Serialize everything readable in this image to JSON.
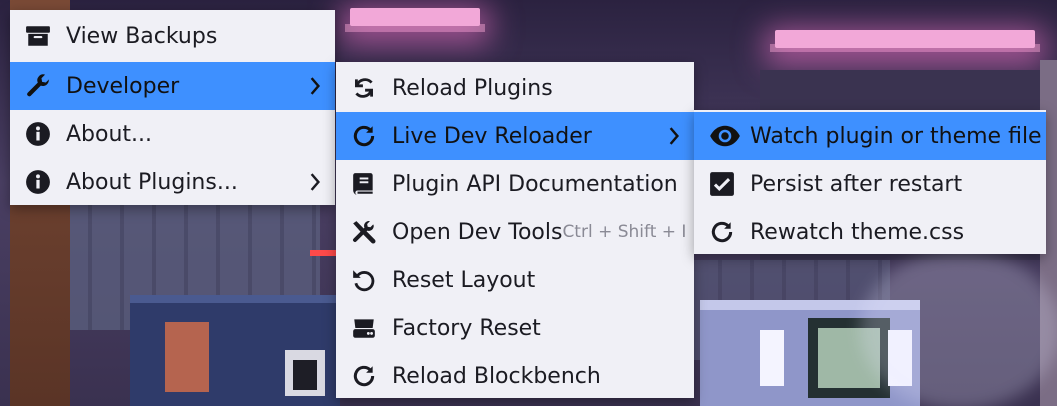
{
  "menu_main": {
    "items": [
      {
        "label": "View Backups",
        "icon": "archive-icon"
      },
      {
        "label": "Developer",
        "icon": "wrench-icon",
        "submenu": true,
        "active": true
      },
      {
        "label": "About...",
        "icon": "info-icon"
      },
      {
        "label": "About Plugins...",
        "icon": "info-icon",
        "submenu": true
      }
    ]
  },
  "menu_developer": {
    "items": [
      {
        "label": "Reload Plugins",
        "icon": "sync-icon"
      },
      {
        "label": "Live Dev Reloader",
        "icon": "refresh-icon",
        "submenu": true,
        "active": true
      },
      {
        "label": "Plugin API Documentation",
        "icon": "book-icon"
      },
      {
        "label": "Open Dev Tools",
        "icon": "tools-icon",
        "shortcut": "Ctrl + Shift + I"
      },
      {
        "label": "Reset Layout",
        "icon": "undo-icon"
      },
      {
        "label": "Factory Reset",
        "icon": "server-icon"
      },
      {
        "label": "Reload Blockbench",
        "icon": "refresh-icon"
      }
    ]
  },
  "menu_live_reloader": {
    "items": [
      {
        "label": "Watch plugin or theme file",
        "icon": "eye-icon",
        "active": true
      },
      {
        "label": "Persist after restart",
        "icon": "checkbox-checked-icon"
      },
      {
        "label": "Rewatch theme.css",
        "icon": "refresh-icon"
      }
    ]
  },
  "colors": {
    "menu_bg": "#f0f0f6",
    "highlight": "#3e90ff",
    "text": "#1b1b22",
    "shortcut_text": "#8a8a95"
  }
}
